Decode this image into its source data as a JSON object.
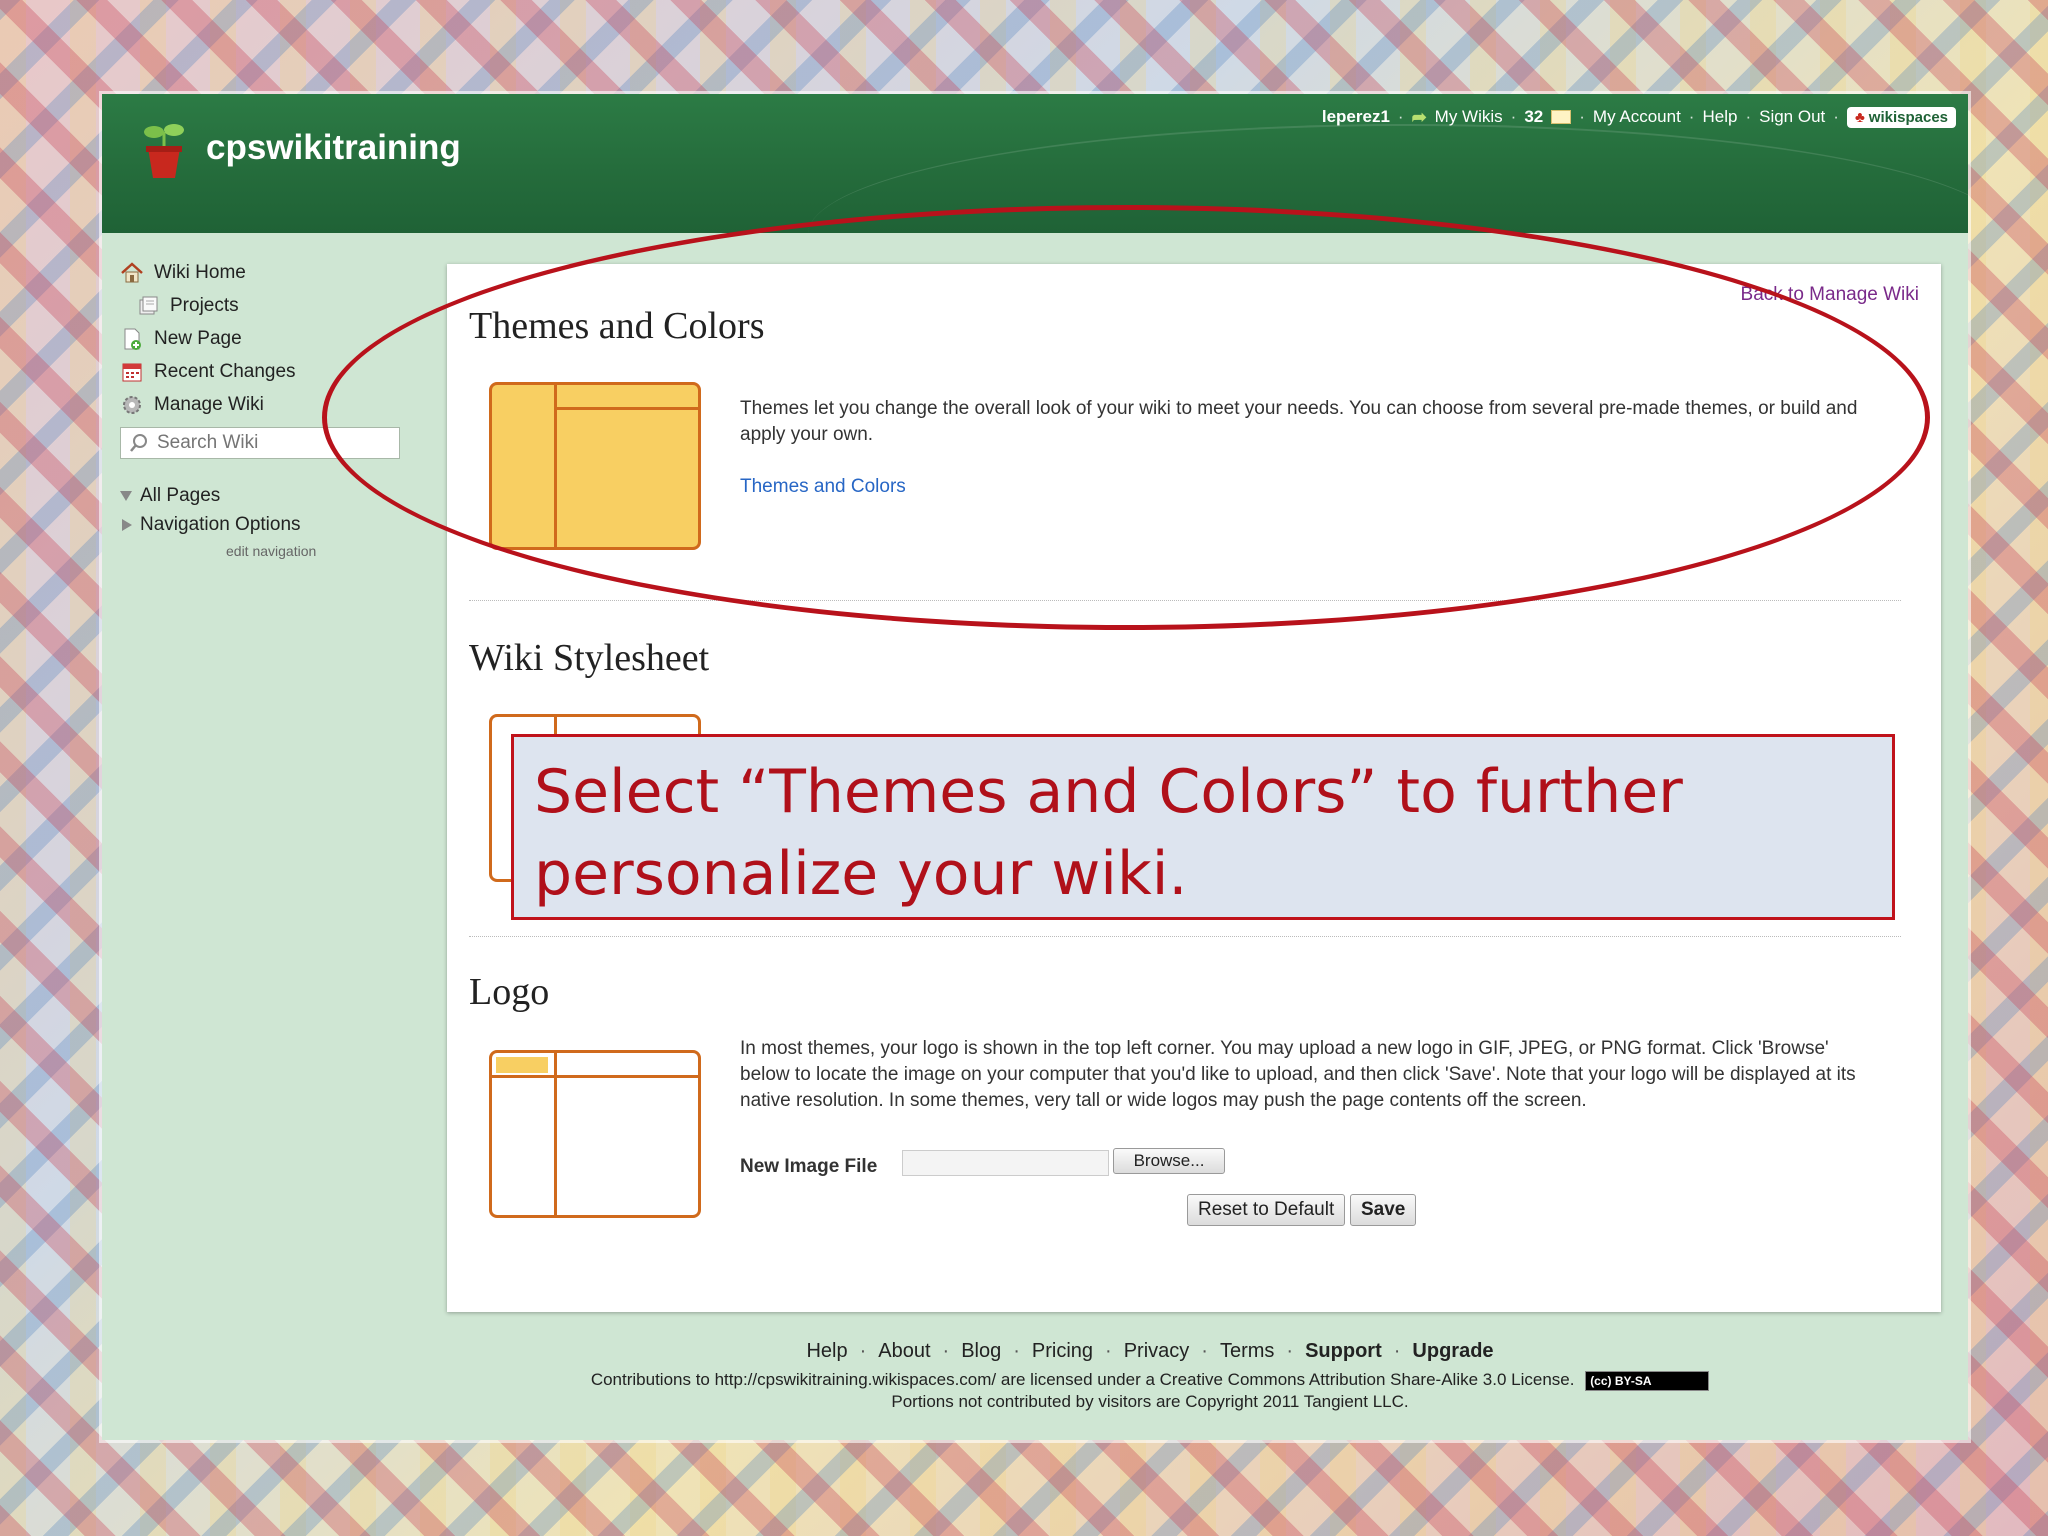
{
  "site": {
    "title": "cpswikitraining"
  },
  "topbar": {
    "user": "leperez1",
    "my_wikis": "My Wikis",
    "messages_count": "32",
    "my_account": "My Account",
    "help": "Help",
    "sign_out": "Sign Out",
    "brand": "wikispaces"
  },
  "sidebar": {
    "items": [
      {
        "label": "Wiki Home",
        "icon": "home-icon"
      },
      {
        "label": "Projects",
        "icon": "projects-icon"
      },
      {
        "label": "New Page",
        "icon": "new-page-icon"
      },
      {
        "label": "Recent Changes",
        "icon": "calendar-icon"
      },
      {
        "label": "Manage Wiki",
        "icon": "gear-icon"
      }
    ],
    "search_placeholder": "Search Wiki",
    "tree": [
      {
        "label": "All Pages",
        "expanded": true
      },
      {
        "label": "Navigation Options",
        "expanded": false
      }
    ],
    "edit_navigation": "edit navigation"
  },
  "content": {
    "back_link": "Back to Manage Wiki",
    "themes": {
      "title": "Themes and Colors",
      "description": "Themes let you change the overall look of your wiki to meet your needs. You can choose from several pre-made themes, or build and apply your own.",
      "link": "Themes and Colors"
    },
    "stylesheet": {
      "title": "Wiki Stylesheet"
    },
    "logo": {
      "title": "Logo",
      "description": "In most themes, your logo is shown in the top left corner. You may upload a new logo in GIF, JPEG, or PNG format. Click 'Browse' below to locate the image on your computer that you'd like to upload, and then click 'Save'. Note that your logo will be displayed at its native resolution. In some themes, very tall or wide logos may push the page contents off the screen.",
      "file_label": "New Image File",
      "browse": "Browse...",
      "reset": "Reset to Default",
      "save": "Save"
    }
  },
  "callout": {
    "text": "Select “Themes and Colors” to further personalize your wiki."
  },
  "footer": {
    "links": [
      "Help",
      "About",
      "Blog",
      "Pricing",
      "Privacy",
      "Terms",
      "Support",
      "Upgrade"
    ],
    "license": "Contributions to http://cpswikitraining.wikispaces.com/ are licensed under a Creative Commons Attribution Share-Alike 3.0 License.",
    "cc_badge": "BY-SA",
    "copyright": "Portions not contributed by visitors are Copyright 2011 Tangient LLC."
  },
  "colors": {
    "header_green": "#246b3b",
    "slide_bg": "#cfe6d3",
    "accent_red": "#b8121b",
    "illustration_orange": "#d06a1c",
    "illustration_fill": "#f8cf62",
    "link_blue": "#2766c5"
  }
}
